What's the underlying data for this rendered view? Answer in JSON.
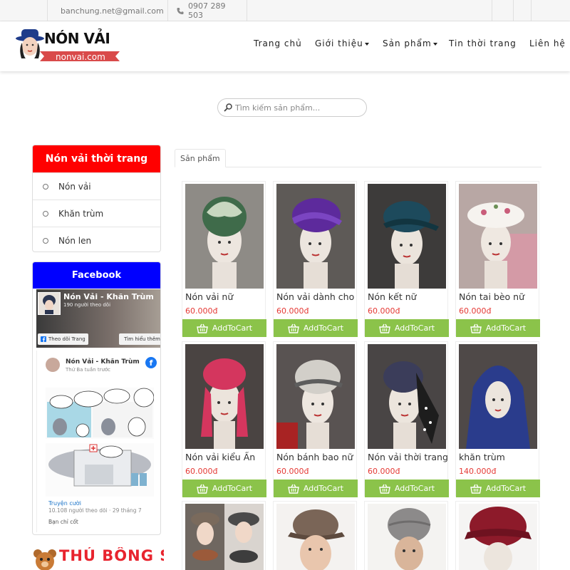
{
  "topbar": {
    "email": "banchung.net@gmail.com",
    "phone": "0907 289 503"
  },
  "header": {
    "logo_title": "NÓN VẢI",
    "logo_sub": "nonvai.com",
    "nav": [
      {
        "label": "Trang chủ"
      },
      {
        "label": "Giới thiệu"
      },
      {
        "label": "Sản phẩm"
      },
      {
        "label": "Tin thời trang"
      },
      {
        "label": "Liên hệ"
      }
    ]
  },
  "search": {
    "placeholder": "Tìm kiếm sản phẩm..."
  },
  "sidebar": {
    "category_title": "Nón vải thời trang",
    "categories": [
      {
        "label": "Nón vải"
      },
      {
        "label": "Khăn trùm"
      },
      {
        "label": "Nón len"
      }
    ],
    "facebook": {
      "title": "Facebook",
      "page_name": "Nón Vải - Khăn Trùm",
      "followers": "190 người theo dõi",
      "follow_btn": "Theo dõi Trang",
      "learn_btn": "Tìm hiểu thêm",
      "post_author": "Nón Vải - Khăn Trùm",
      "post_time": "Thứ Ba tuần trước",
      "shared_source": "Truyện cười",
      "shared_meta": "10.108 người theo dõi · 29 tháng 7",
      "post_more": "Bạn chỉ cốt"
    },
    "banner_text": "THÚ BÔNG SỈ"
  },
  "main": {
    "tab_label": "Sản phẩm",
    "cart_label": "AddToCart",
    "products": [
      {
        "name": "Nón vải nữ",
        "price": "60.000đ"
      },
      {
        "name": "Nón vải dành cho",
        "price": "60.000đ"
      },
      {
        "name": "Nón kết nữ",
        "price": "60.000đ"
      },
      {
        "name": "Nón tai bèo nữ",
        "price": "60.000đ"
      },
      {
        "name": "Nón vải kiểu Ấn",
        "price": "60.000đ"
      },
      {
        "name": "Nón bánh bao nữ",
        "price": "60.000đ"
      },
      {
        "name": "Nón vải thời trang",
        "price": "60.000đ"
      },
      {
        "name": "khăn trùm",
        "price": "140.000đ"
      }
    ]
  },
  "colors": {
    "category_header": "#ff0000",
    "facebook_header": "#0000ff",
    "cart_button": "#8bc34a",
    "price": "#e53935"
  }
}
